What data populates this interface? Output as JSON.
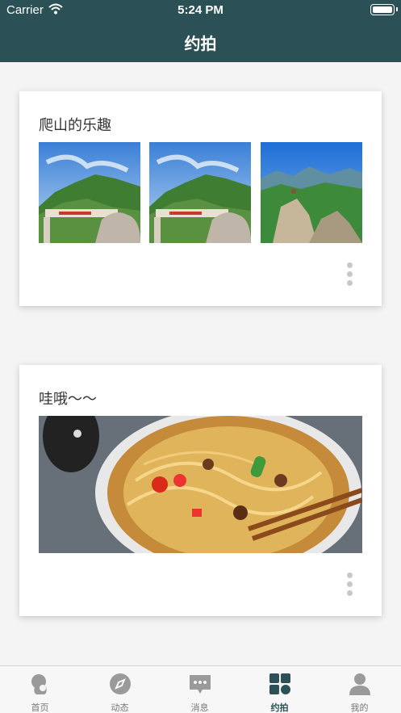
{
  "status_bar": {
    "carrier": "Carrier",
    "time": "5:24 PM"
  },
  "nav": {
    "title": "约拍"
  },
  "posts": [
    {
      "title": "爬山的乐趣"
    },
    {
      "title": "哇哦～～"
    }
  ],
  "tabbar": {
    "items": [
      {
        "label": "首页",
        "icon": "home-icon"
      },
      {
        "label": "动态",
        "icon": "compass-icon"
      },
      {
        "label": "消息",
        "icon": "chat-icon"
      },
      {
        "label": "约拍",
        "icon": "grid-icon",
        "active": true
      },
      {
        "label": "我的",
        "icon": "person-icon"
      }
    ]
  },
  "colors": {
    "primary": "#2b5156",
    "inactive": "#9a9a9a"
  }
}
